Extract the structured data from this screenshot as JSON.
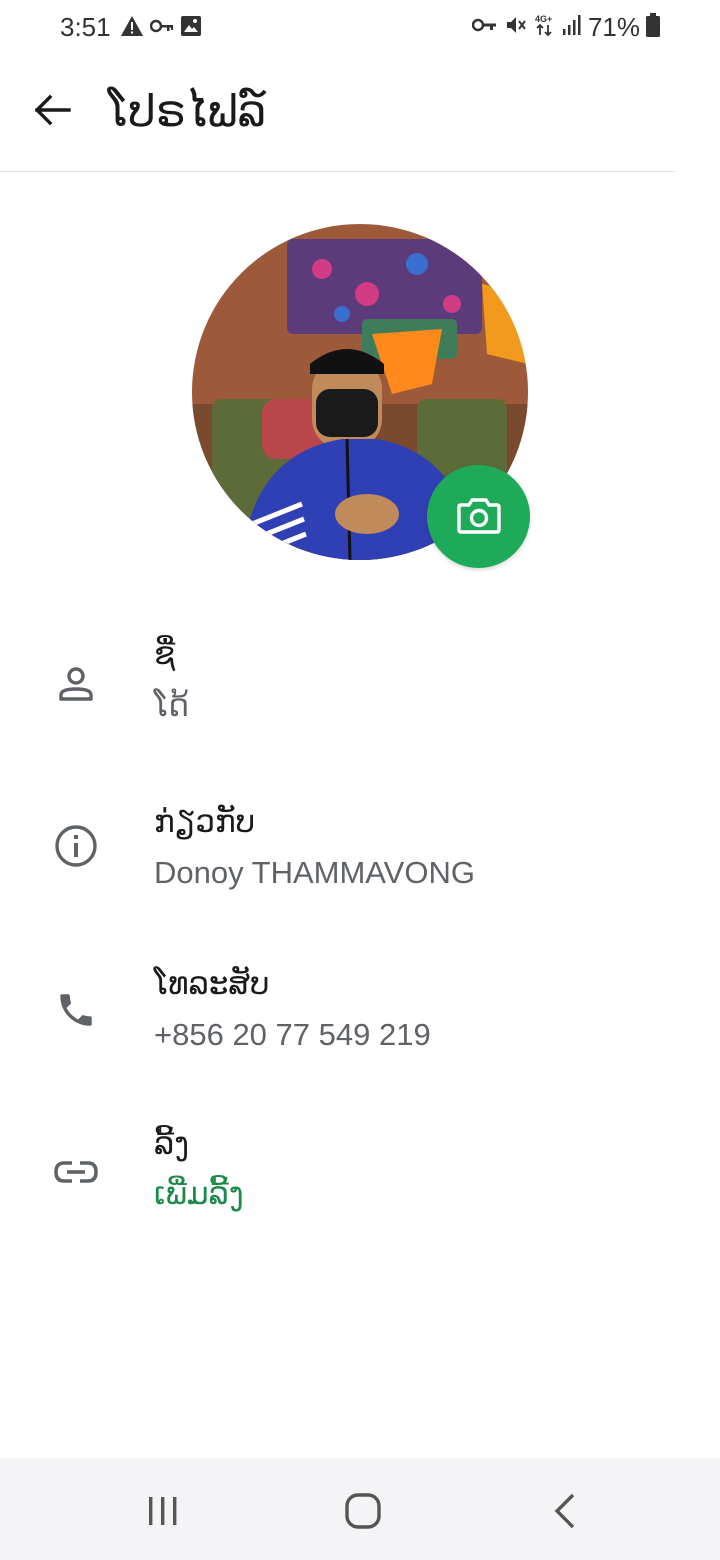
{
  "status_bar": {
    "time": "3:51",
    "battery": "71%",
    "left_icons": [
      "warning-icon",
      "key-icon",
      "image-icon"
    ],
    "right_icons": [
      "vpn-key-icon",
      "mute-icon",
      "4g-data-icon",
      "signal-icon",
      "battery-icon"
    ]
  },
  "app_bar": {
    "title": "ໂປຣໄຟລ໌",
    "back_icon": "back-arrow-icon"
  },
  "profile": {
    "avatar_icon": "profile-photo",
    "camera_icon": "camera-icon",
    "accent_color": "#1faa5a"
  },
  "fields": {
    "name": {
      "icon": "person-icon",
      "label": "ຊື່",
      "value": "ໂດ້"
    },
    "about": {
      "icon": "info-icon",
      "label": "ກ່ຽວກັບ",
      "value": "Donoy THAMMAVONG"
    },
    "phone": {
      "icon": "phone-icon",
      "label": "ໂທລະສັບ",
      "value": "+856 20 77 549 219"
    },
    "links": {
      "icon": "link-icon",
      "label": "ລີ້ງ",
      "value": "ເພີ່ມລີ້ງ",
      "value_color": "#1b8a4a"
    }
  },
  "nav_bar": {
    "recents_icon": "recents-icon",
    "home_icon": "home-icon",
    "back_icon": "back-icon"
  }
}
